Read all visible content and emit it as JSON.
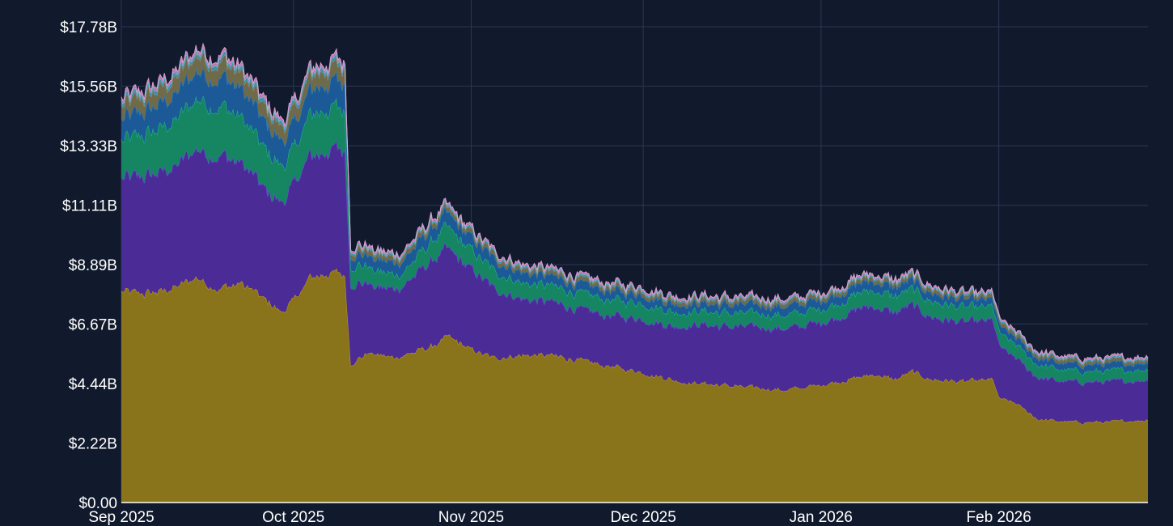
{
  "chart_data": {
    "type": "area",
    "stacked": true,
    "grid": true,
    "legend": "none",
    "background": "#111a2d",
    "grid_color": "#2a3655",
    "x_start": "2025-09-01",
    "x_end": "2026-02-27",
    "ylim": [
      0,
      17.78
    ],
    "yticks": [
      "$0.00",
      "$2.22B",
      "$4.44B",
      "$6.67B",
      "$8.89B",
      "$11.11B",
      "$13.33B",
      "$15.56B",
      "$17.78B"
    ],
    "ytick_values": [
      0,
      2.22,
      4.44,
      6.67,
      8.89,
      11.11,
      13.33,
      15.56,
      17.78
    ],
    "xticks": [
      {
        "label": "Sep 2025",
        "date": "2025-09-01"
      },
      {
        "label": "Oct 2025",
        "date": "2025-10-01"
      },
      {
        "label": "Nov 2025",
        "date": "2025-11-01"
      },
      {
        "label": "Dec 2025",
        "date": "2025-12-01"
      },
      {
        "label": "Jan 2026",
        "date": "2026-01-01"
      },
      {
        "label": "Feb 2026",
        "date": "2026-02-01"
      }
    ],
    "total_anchors": [
      [
        "2025-09-01",
        15.2
      ],
      [
        "2025-09-03",
        15.4
      ],
      [
        "2025-09-05",
        15.9
      ],
      [
        "2025-09-08",
        15.8
      ],
      [
        "2025-09-10",
        16.1
      ],
      [
        "2025-09-12",
        17.3
      ],
      [
        "2025-09-14",
        17.4
      ],
      [
        "2025-09-16",
        16.2
      ],
      [
        "2025-09-18",
        17.0
      ],
      [
        "2025-09-20",
        17.3
      ],
      [
        "2025-09-22",
        16.8
      ],
      [
        "2025-09-24",
        15.0
      ],
      [
        "2025-09-27",
        14.6
      ],
      [
        "2025-09-29",
        14.0
      ],
      [
        "2025-10-01",
        14.8
      ],
      [
        "2025-10-03",
        16.2
      ],
      [
        "2025-10-05",
        16.7
      ],
      [
        "2025-10-07",
        16.8
      ],
      [
        "2025-10-09",
        16.7
      ],
      [
        "2025-10-10",
        16.8
      ],
      [
        "2025-10-11",
        10.0
      ],
      [
        "2025-10-13",
        10.7
      ],
      [
        "2025-10-16",
        10.1
      ],
      [
        "2025-10-19",
        10.5
      ],
      [
        "2025-10-22",
        10.4
      ],
      [
        "2025-10-25",
        10.9
      ],
      [
        "2025-10-27",
        11.3
      ],
      [
        "2025-10-30",
        10.6
      ],
      [
        "2025-11-02",
        10.2
      ],
      [
        "2025-11-05",
        9.8
      ],
      [
        "2025-11-08",
        9.1
      ],
      [
        "2025-11-12",
        9.0
      ],
      [
        "2025-11-16",
        8.8
      ],
      [
        "2025-11-20",
        8.9
      ],
      [
        "2025-11-24",
        8.6
      ],
      [
        "2025-11-28",
        8.5
      ],
      [
        "2025-12-02",
        8.6
      ],
      [
        "2025-12-05",
        8.2
      ],
      [
        "2025-12-08",
        8.1
      ],
      [
        "2025-12-12",
        7.8
      ],
      [
        "2025-12-16",
        8.0
      ],
      [
        "2025-12-20",
        7.9
      ],
      [
        "2025-12-24",
        7.7
      ],
      [
        "2025-12-28",
        7.6
      ],
      [
        "2026-01-01",
        7.9
      ],
      [
        "2026-01-04",
        8.2
      ],
      [
        "2026-01-07",
        8.8
      ],
      [
        "2026-01-10",
        8.7
      ],
      [
        "2026-01-13",
        8.5
      ],
      [
        "2026-01-16",
        8.9
      ],
      [
        "2026-01-19",
        8.5
      ],
      [
        "2026-01-22",
        8.2
      ],
      [
        "2026-01-25",
        7.8
      ],
      [
        "2026-01-28",
        7.6
      ],
      [
        "2026-01-31",
        7.6
      ],
      [
        "2026-02-01",
        6.9
      ],
      [
        "2026-02-04",
        6.4
      ],
      [
        "2026-02-07",
        6.0
      ],
      [
        "2026-02-10",
        5.8
      ],
      [
        "2026-02-14",
        5.6
      ],
      [
        "2026-02-18",
        5.5
      ],
      [
        "2026-02-22",
        5.5
      ],
      [
        "2026-02-26",
        5.5
      ],
      [
        "2026-02-27",
        6.4
      ]
    ],
    "series": [
      {
        "color": "#8a741b",
        "line": "#c9a227",
        "values": [
          [
            "2025-09-01",
            7.9
          ],
          [
            "2025-09-05",
            7.8
          ],
          [
            "2025-09-10",
            8.0
          ],
          [
            "2025-09-14",
            8.4
          ],
          [
            "2025-09-18",
            8.0
          ],
          [
            "2025-09-22",
            8.2
          ],
          [
            "2025-09-26",
            7.6
          ],
          [
            "2025-09-29",
            7.1
          ],
          [
            "2025-10-02",
            7.8
          ],
          [
            "2025-10-04",
            8.4
          ],
          [
            "2025-10-08",
            8.6
          ],
          [
            "2025-10-10",
            8.5
          ],
          [
            "2025-10-11",
            5.2
          ],
          [
            "2025-10-14",
            5.6
          ],
          [
            "2025-10-18",
            5.4
          ],
          [
            "2025-10-22",
            5.6
          ],
          [
            "2025-10-26",
            5.9
          ],
          [
            "2025-10-28",
            6.2
          ],
          [
            "2025-11-01",
            5.7
          ],
          [
            "2025-11-05",
            5.4
          ],
          [
            "2025-11-10",
            5.5
          ],
          [
            "2025-11-15",
            5.5
          ],
          [
            "2025-11-20",
            5.3
          ],
          [
            "2025-11-25",
            5.1
          ],
          [
            "2025-11-30",
            4.9
          ],
          [
            "2025-12-04",
            4.7
          ],
          [
            "2025-12-08",
            4.5
          ],
          [
            "2025-12-14",
            4.4
          ],
          [
            "2025-12-20",
            4.3
          ],
          [
            "2025-12-26",
            4.2
          ],
          [
            "2026-01-01",
            4.4
          ],
          [
            "2026-01-06",
            4.6
          ],
          [
            "2026-01-10",
            4.8
          ],
          [
            "2026-01-14",
            4.6
          ],
          [
            "2026-01-17",
            4.9
          ],
          [
            "2026-01-20",
            4.6
          ],
          [
            "2026-01-26",
            4.5
          ],
          [
            "2026-01-31",
            4.6
          ],
          [
            "2026-02-01",
            3.9
          ],
          [
            "2026-02-04",
            3.7
          ],
          [
            "2026-02-08",
            3.1
          ],
          [
            "2026-02-14",
            3.0
          ],
          [
            "2026-02-20",
            3.0
          ],
          [
            "2026-02-27",
            3.1
          ]
        ]
      },
      {
        "color": "#4b2b96",
        "line": "#7c4dff",
        "values": [
          [
            "2025-09-01",
            4.2
          ],
          [
            "2025-09-06",
            4.4
          ],
          [
            "2025-09-10",
            4.5
          ],
          [
            "2025-09-14",
            4.8
          ],
          [
            "2025-09-18",
            5.0
          ],
          [
            "2025-09-22",
            4.5
          ],
          [
            "2025-09-26",
            4.1
          ],
          [
            "2025-09-29",
            4.1
          ],
          [
            "2025-10-03",
            4.5
          ],
          [
            "2025-10-07",
            4.6
          ],
          [
            "2025-10-10",
            4.6
          ],
          [
            "2025-10-11",
            3.0
          ],
          [
            "2025-10-15",
            2.5
          ],
          [
            "2025-10-20",
            2.6
          ],
          [
            "2025-10-25",
            3.2
          ],
          [
            "2025-10-27",
            3.3
          ],
          [
            "2025-11-01",
            3.0
          ],
          [
            "2025-11-05",
            2.6
          ],
          [
            "2025-11-10",
            2.1
          ],
          [
            "2025-11-15",
            2.0
          ],
          [
            "2025-11-20",
            1.9
          ],
          [
            "2025-11-25",
            1.9
          ],
          [
            "2025-12-01",
            2.0
          ],
          [
            "2025-12-06",
            2.0
          ],
          [
            "2025-12-10",
            2.2
          ],
          [
            "2025-12-16",
            2.2
          ],
          [
            "2025-12-22",
            2.3
          ],
          [
            "2025-12-28",
            2.3
          ],
          [
            "2026-01-04",
            2.4
          ],
          [
            "2026-01-08",
            2.6
          ],
          [
            "2026-01-12",
            2.5
          ],
          [
            "2026-01-16",
            2.5
          ],
          [
            "2026-01-22",
            2.3
          ],
          [
            "2026-01-28",
            2.2
          ],
          [
            "2026-01-31",
            2.2
          ],
          [
            "2026-02-02",
            1.8
          ],
          [
            "2026-02-06",
            1.6
          ],
          [
            "2026-02-12",
            1.5
          ],
          [
            "2026-02-20",
            1.5
          ],
          [
            "2026-02-27",
            1.5
          ]
        ]
      },
      {
        "color": "#168562",
        "line": "#26c490",
        "values": [
          [
            "2025-09-01",
            1.4
          ],
          [
            "2025-09-10",
            1.7
          ],
          [
            "2025-09-15",
            1.9
          ],
          [
            "2025-09-20",
            1.8
          ],
          [
            "2025-09-26",
            1.5
          ],
          [
            "2025-10-01",
            1.3
          ],
          [
            "2025-10-05",
            1.6
          ],
          [
            "2025-10-10",
            1.5
          ],
          [
            "2025-10-11",
            0.7
          ],
          [
            "2025-10-20",
            0.5
          ],
          [
            "2025-10-27",
            0.8
          ],
          [
            "2025-11-02",
            0.7
          ],
          [
            "2025-11-10",
            0.6
          ],
          [
            "2025-11-20",
            0.6
          ],
          [
            "2025-12-01",
            0.6
          ],
          [
            "2025-12-10",
            0.5
          ],
          [
            "2025-12-20",
            0.5
          ],
          [
            "2026-01-01",
            0.5
          ],
          [
            "2026-01-10",
            0.6
          ],
          [
            "2026-01-20",
            0.6
          ],
          [
            "2026-01-31",
            0.5
          ],
          [
            "2026-02-05",
            0.5
          ],
          [
            "2026-02-15",
            0.4
          ],
          [
            "2026-02-27",
            0.4
          ]
        ]
      },
      {
        "color": "#1b5a96",
        "line": "#2a86d6",
        "values": [
          [
            "2025-09-01",
            0.8
          ],
          [
            "2025-09-12",
            1.0
          ],
          [
            "2025-09-20",
            1.1
          ],
          [
            "2025-10-01",
            0.9
          ],
          [
            "2025-10-10",
            1.0
          ],
          [
            "2025-10-11",
            0.4
          ],
          [
            "2025-10-27",
            0.5
          ],
          [
            "2025-11-15",
            0.35
          ],
          [
            "2025-12-10",
            0.3
          ],
          [
            "2026-01-10",
            0.35
          ],
          [
            "2026-02-05",
            0.25
          ],
          [
            "2026-02-27",
            0.25
          ]
        ]
      },
      {
        "color": "#6f6a4a",
        "line": "#9b9468",
        "values": [
          [
            "2025-09-01",
            0.5
          ],
          [
            "2025-09-15",
            0.6
          ],
          [
            "2025-10-01",
            0.5
          ],
          [
            "2025-10-10",
            0.55
          ],
          [
            "2025-10-11",
            0.2
          ],
          [
            "2025-11-15",
            0.15
          ],
          [
            "2026-01-10",
            0.15
          ],
          [
            "2026-02-27",
            0.12
          ]
        ]
      },
      {
        "color": "#3f8fb3",
        "line": "#7fd3e6",
        "values": [
          [
            "2025-09-01",
            0.15
          ],
          [
            "2025-10-10",
            0.15
          ],
          [
            "2025-10-11",
            0.08
          ],
          [
            "2026-02-27",
            0.06
          ]
        ]
      },
      {
        "color": "#b57aa8",
        "line": "#e9a3d8",
        "values": [
          [
            "2025-09-01",
            0.12
          ],
          [
            "2025-10-10",
            0.12
          ],
          [
            "2025-10-11",
            0.08
          ],
          [
            "2026-02-27",
            0.06
          ]
        ]
      }
    ]
  }
}
